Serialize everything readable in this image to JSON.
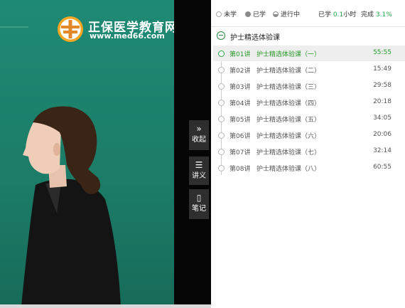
{
  "logo": {
    "title": "正保医学教育网",
    "url": "www.med66.com"
  },
  "side": {
    "collapse": {
      "label": "收起",
      "icon": "»"
    },
    "notes_pdf": {
      "label": "讲义",
      "icon": "☰"
    },
    "notes": {
      "label": "笔记",
      "icon": "▯"
    }
  },
  "legend": {
    "unlearned": "未学",
    "learned": "已学",
    "in_progress": "进行中",
    "studied_prefix": "已学",
    "studied_value": "0.1",
    "studied_unit": "小时",
    "complete_prefix": "完成",
    "complete_value": "3.1%"
  },
  "course": {
    "title": "护士精选体验课"
  },
  "lessons": [
    {
      "num": "第01讲",
      "name": "护士精选体验课（一）",
      "duration": "55:55"
    },
    {
      "num": "第02讲",
      "name": "护士精选体验课（二）",
      "duration": "15:49"
    },
    {
      "num": "第03讲",
      "name": "护士精选体验课（三）",
      "duration": "29:58"
    },
    {
      "num": "第04讲",
      "name": "护士精选体验课（四）",
      "duration": "20:18"
    },
    {
      "num": "第05讲",
      "name": "护士精选体验课（五）",
      "duration": "34:05"
    },
    {
      "num": "第06讲",
      "name": "护士精选体验课（六）",
      "duration": "20:06"
    },
    {
      "num": "第07讲",
      "name": "护士精选体验课（七）",
      "duration": "32:14"
    },
    {
      "num": "第08讲",
      "name": "护士精选体验课（八）",
      "duration": "60:55"
    }
  ],
  "colors": {
    "accent_green": "#28a745",
    "board_green": "#1c7a68"
  }
}
